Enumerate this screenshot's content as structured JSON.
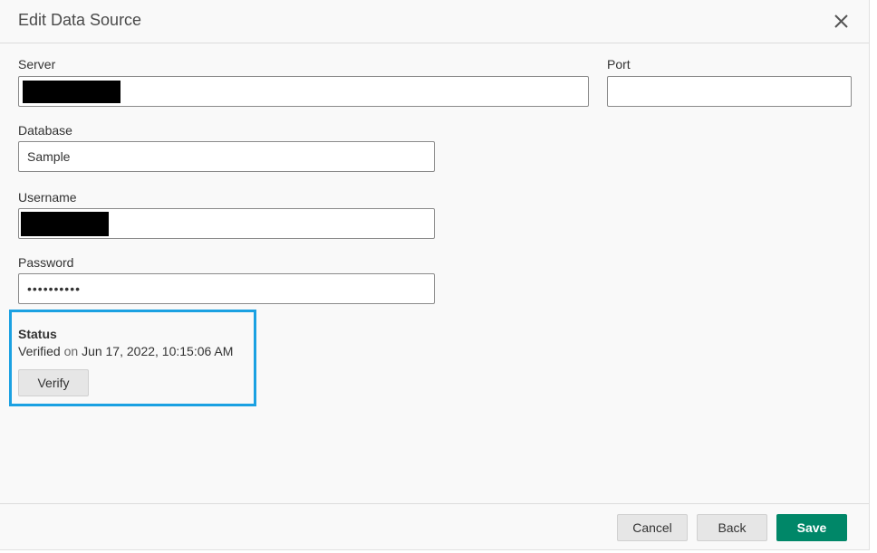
{
  "dialog": {
    "title": "Edit Data Source",
    "close_icon": "close-icon"
  },
  "form": {
    "server": {
      "label": "Server",
      "value": ""
    },
    "port": {
      "label": "Port",
      "value": ""
    },
    "database": {
      "label": "Database",
      "value": "Sample"
    },
    "username": {
      "label": "Username",
      "value": ""
    },
    "password": {
      "label": "Password",
      "value": "••••••••••"
    }
  },
  "status": {
    "heading": "Status",
    "state": "Verified",
    "on_word": "on",
    "timestamp": "Jun 17, 2022, 10:15:06 AM",
    "verify_label": "Verify",
    "highlight_color": "#1ba1e2"
  },
  "footer": {
    "cancel_label": "Cancel",
    "back_label": "Back",
    "save_label": "Save",
    "save_color": "#008768"
  }
}
